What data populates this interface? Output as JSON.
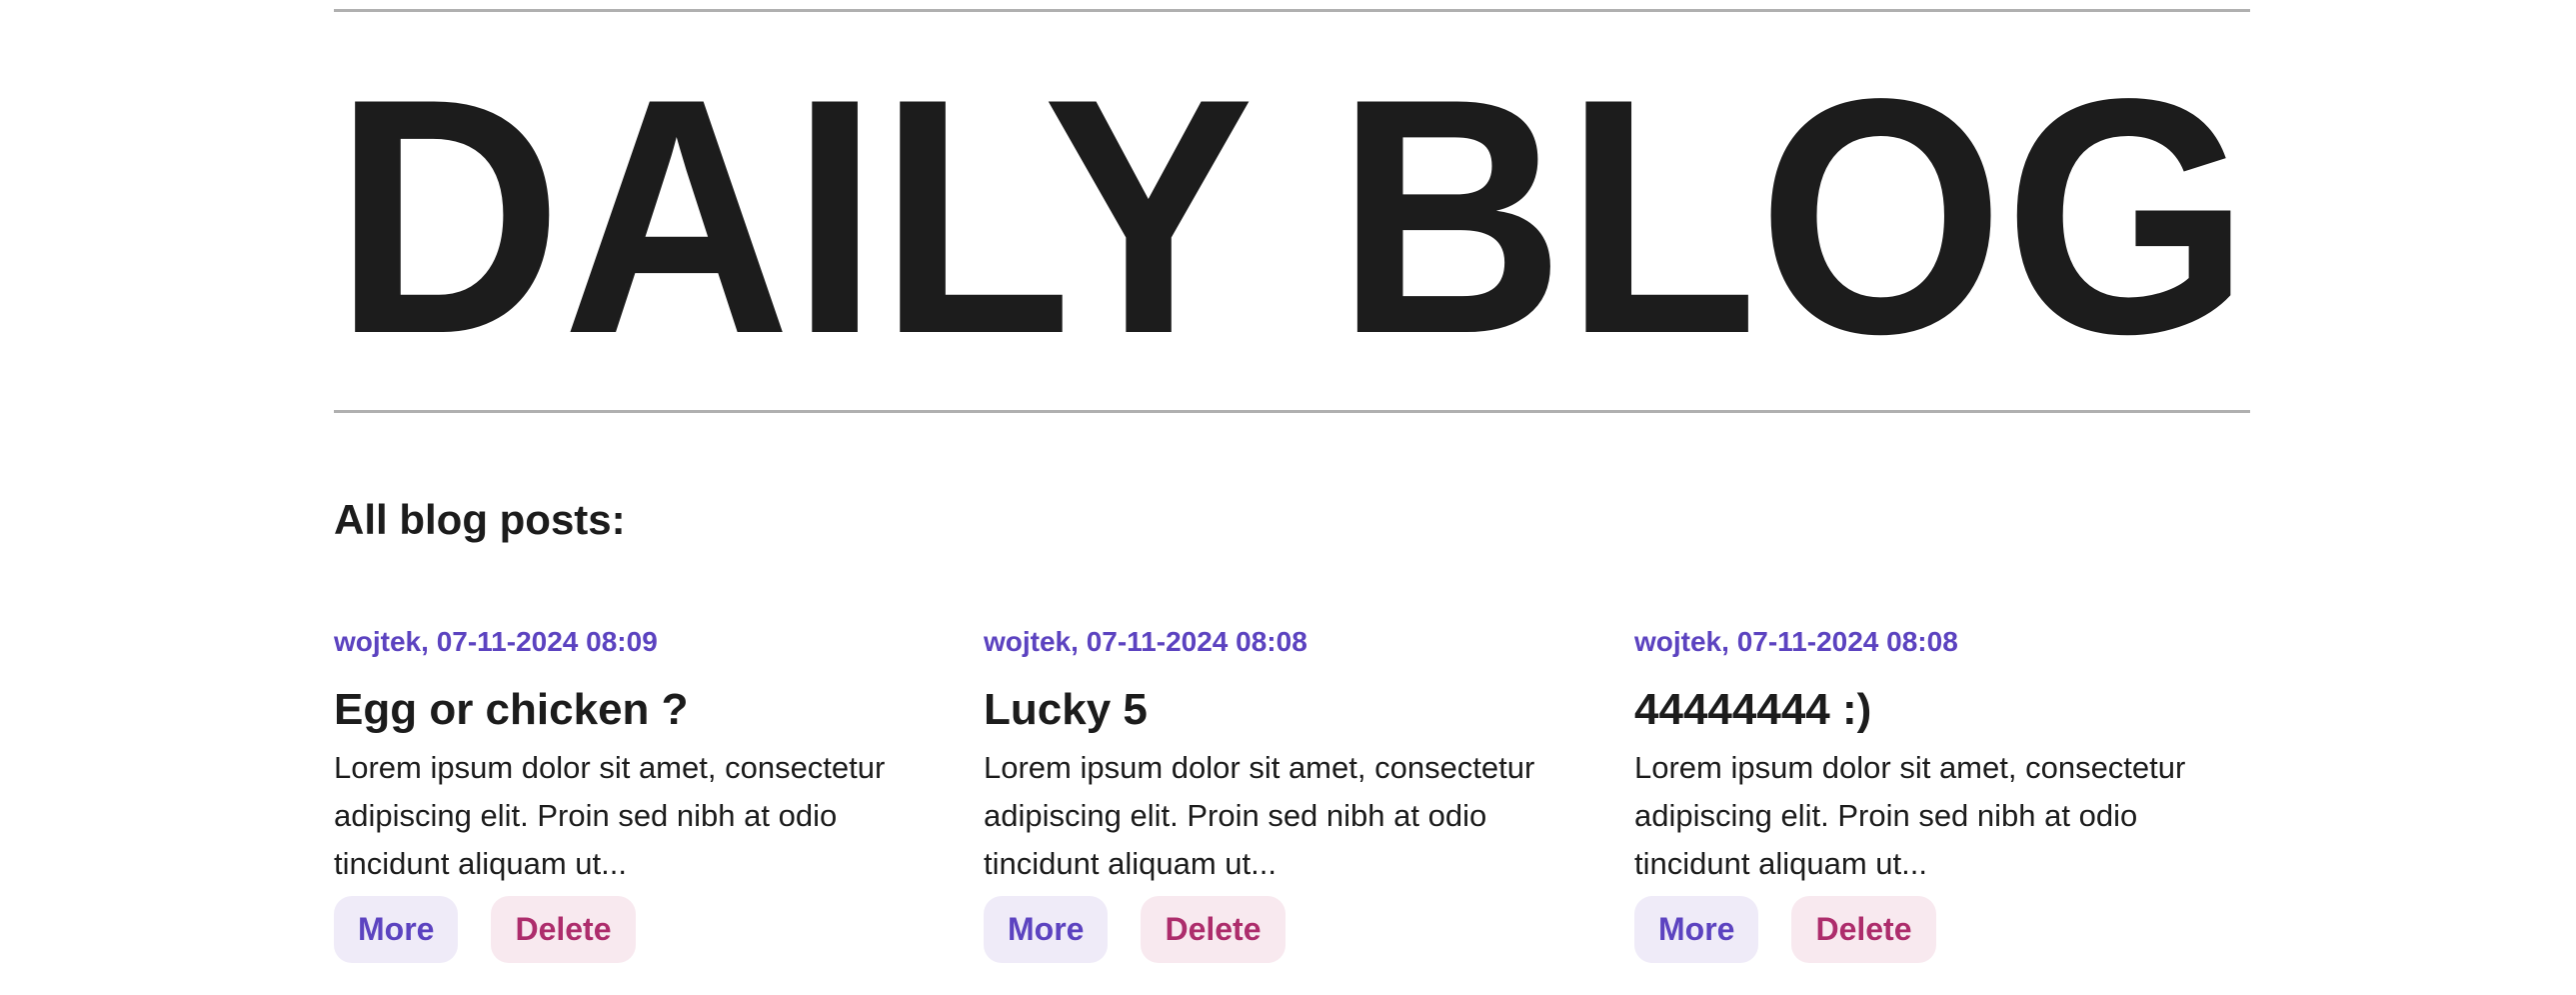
{
  "header": {
    "title": "DAILY BLOG"
  },
  "section_heading": "All blog posts:",
  "colors": {
    "accent": "#5c43c0",
    "danger": "#ad2d6c",
    "text": "#1c1c1c",
    "rule": "#b0b0b0"
  },
  "posts": [
    {
      "meta": "wojtek, 07-11-2024 08:09",
      "title": "Egg or chicken ?",
      "excerpt": "Lorem ipsum dolor sit amet, consectetur adipiscing elit. Proin sed nibh at odio tincidunt aliquam ut...",
      "more_label": "More",
      "delete_label": "Delete"
    },
    {
      "meta": "wojtek, 07-11-2024 08:08",
      "title": "Lucky 5",
      "excerpt": "Lorem ipsum dolor sit amet, consectetur adipiscing elit. Proin sed nibh at odio tincidunt aliquam ut...",
      "more_label": "More",
      "delete_label": "Delete"
    },
    {
      "meta": "wojtek, 07-11-2024 08:08",
      "title": "44444444 :)",
      "excerpt": "Lorem ipsum dolor sit amet, consectetur adipiscing elit. Proin sed nibh at odio tincidunt aliquam ut...",
      "more_label": "More",
      "delete_label": "Delete"
    }
  ]
}
